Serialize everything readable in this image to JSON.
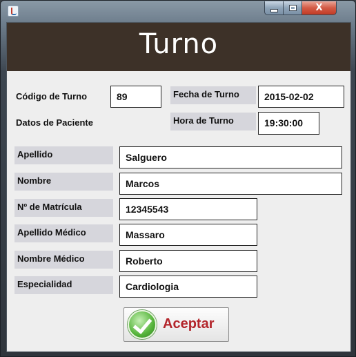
{
  "window": {
    "minimize_label": "",
    "maximize_label": "",
    "close_label": "X"
  },
  "header": {
    "title": "Turno"
  },
  "form": {
    "codigo_label": "Código de Turno",
    "codigo_value": "89",
    "fecha_label": "Fecha de Turno",
    "fecha_value": "2015-02-02",
    "datos_paciente_label": "Datos de Paciente",
    "hora_label": "Hora de Turno",
    "hora_value": "19:30:00",
    "fields": [
      {
        "label": "Apellido",
        "value": "Salguero"
      },
      {
        "label": "Nombre",
        "value": "Marcos"
      },
      {
        "label": "Nº de Matrícula",
        "value": "12345543"
      },
      {
        "label": "Apellido Médico",
        "value": "Massaro"
      },
      {
        "label": "Nombre Médico",
        "value": "Roberto"
      },
      {
        "label": "Especialidad",
        "value": "Cardiologia"
      }
    ]
  },
  "actions": {
    "accept_label": "Aceptar"
  },
  "icons": {
    "app": "java-app-icon",
    "accept": "check-icon"
  },
  "colors": {
    "banner": "#3d3128",
    "accept_text": "#b3252b",
    "close": "#c13b25"
  }
}
